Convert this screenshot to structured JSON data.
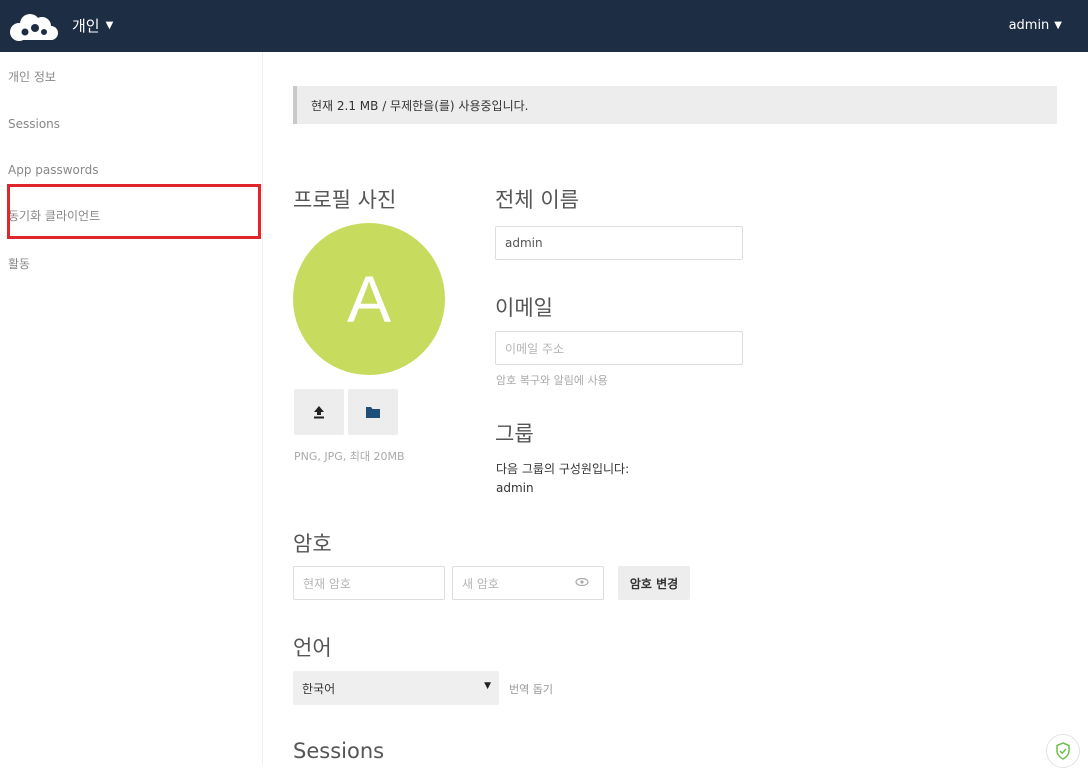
{
  "header": {
    "app_name": "개인",
    "username": "admin",
    "bg_color": "#1d2d44"
  },
  "sidebar": {
    "items": [
      {
        "label": "개인 정보"
      },
      {
        "label": "Sessions"
      },
      {
        "label": "App passwords"
      },
      {
        "label": "동기화 클라이언트"
      },
      {
        "label": "활동"
      }
    ],
    "highlighted_item": "동기화 클라이언트",
    "highlight_color": "#e0262b"
  },
  "quota": {
    "text": "현재 2.1 MB / 무제한을(를) 사용중입니다."
  },
  "profile_picture": {
    "title": "프로필 사진",
    "avatar_letter": "A",
    "avatar_color": "#c7db5e",
    "upload_icon": "upload-icon",
    "folder_icon": "folder-icon",
    "hint": "PNG, JPG, 최대 20MB"
  },
  "full_name": {
    "title": "전체 이름",
    "value": "admin"
  },
  "email": {
    "title": "이메일",
    "placeholder": "이메일 주소",
    "hint": "암호 복구와 알림에 사용"
  },
  "groups": {
    "title": "그룹",
    "description": "다음 그룹의 구성원입니다:",
    "value": "admin"
  },
  "password": {
    "title": "암호",
    "current_placeholder": "현재 암호",
    "new_placeholder": "새 암호",
    "change_button": "암호 변경"
  },
  "language": {
    "title": "언어",
    "selected": "한국어",
    "help_link": "번역 돕기"
  },
  "sessions": {
    "title": "Sessions"
  }
}
